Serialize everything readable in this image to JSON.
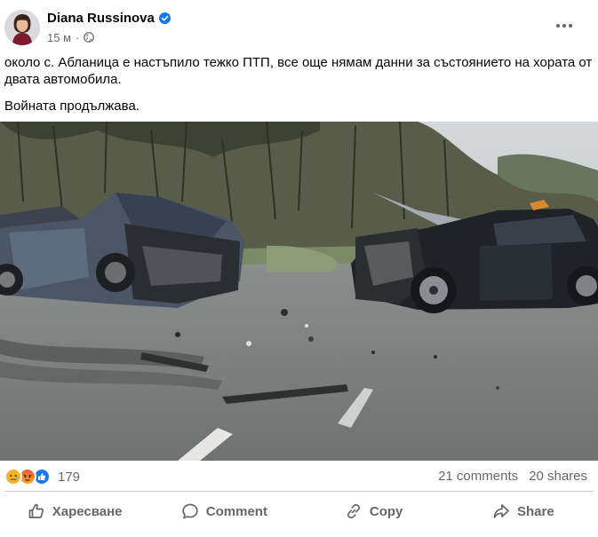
{
  "post": {
    "author": "Diana Russinova",
    "time": "15 м",
    "separator": "·",
    "text_paragraphs": [
      "около с. Абланица е настъпило тежко ПТП, все още нямам данни за състоянието на хората от двата автомобила.",
      "Войната продължава."
    ],
    "reaction_icons": [
      "sad-reaction-icon",
      "angry-reaction-icon",
      "like-reaction-icon"
    ],
    "reaction_count": "179",
    "comments": "21 comments",
    "shares": "20 shares"
  },
  "actions": {
    "like_label": "Харесване",
    "comment_label": "Comment",
    "copy_label": "Copy",
    "share_label": "Share"
  },
  "colors": {
    "accent": "#1877f2",
    "secondary_text": "#65676b",
    "divider": "#ced0d4"
  }
}
